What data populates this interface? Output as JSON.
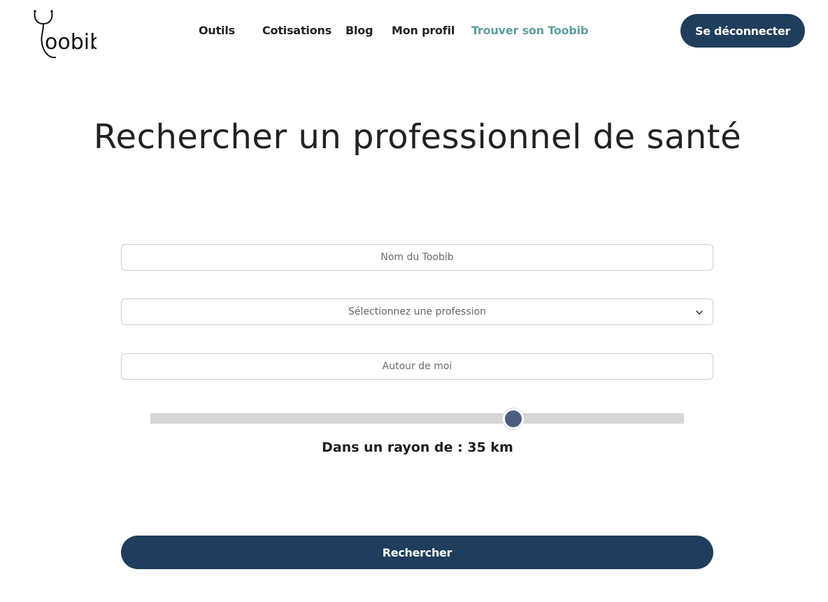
{
  "brand": {
    "logo_text": "Toobib"
  },
  "nav": {
    "items": [
      {
        "label": "Outils"
      },
      {
        "label": "Cotisations"
      },
      {
        "label": "Blog"
      },
      {
        "label": "Mon profil"
      },
      {
        "label": "Trouver son Toobib",
        "active": true
      }
    ],
    "logout_label": "Se déconnecter"
  },
  "page": {
    "title": "Rechercher un professionnel de santé"
  },
  "form": {
    "name_placeholder": "Nom du Toobib",
    "profession_placeholder": "Sélectionnez une profession",
    "location_placeholder": "Autour de moi",
    "radius_label": "Dans un rayon de : 35 km",
    "radius_fraction": 0.68,
    "submit_label": "Rechercher"
  },
  "icons": {
    "select_arrow": "chevron-down-icon",
    "logo": "stethoscope-logo"
  },
  "colors": {
    "primary": "#1f3d5c",
    "active_nav": "#5e9e9e",
    "slider_thumb": "#4b5e80",
    "slider_track": "#d6d6d6"
  }
}
